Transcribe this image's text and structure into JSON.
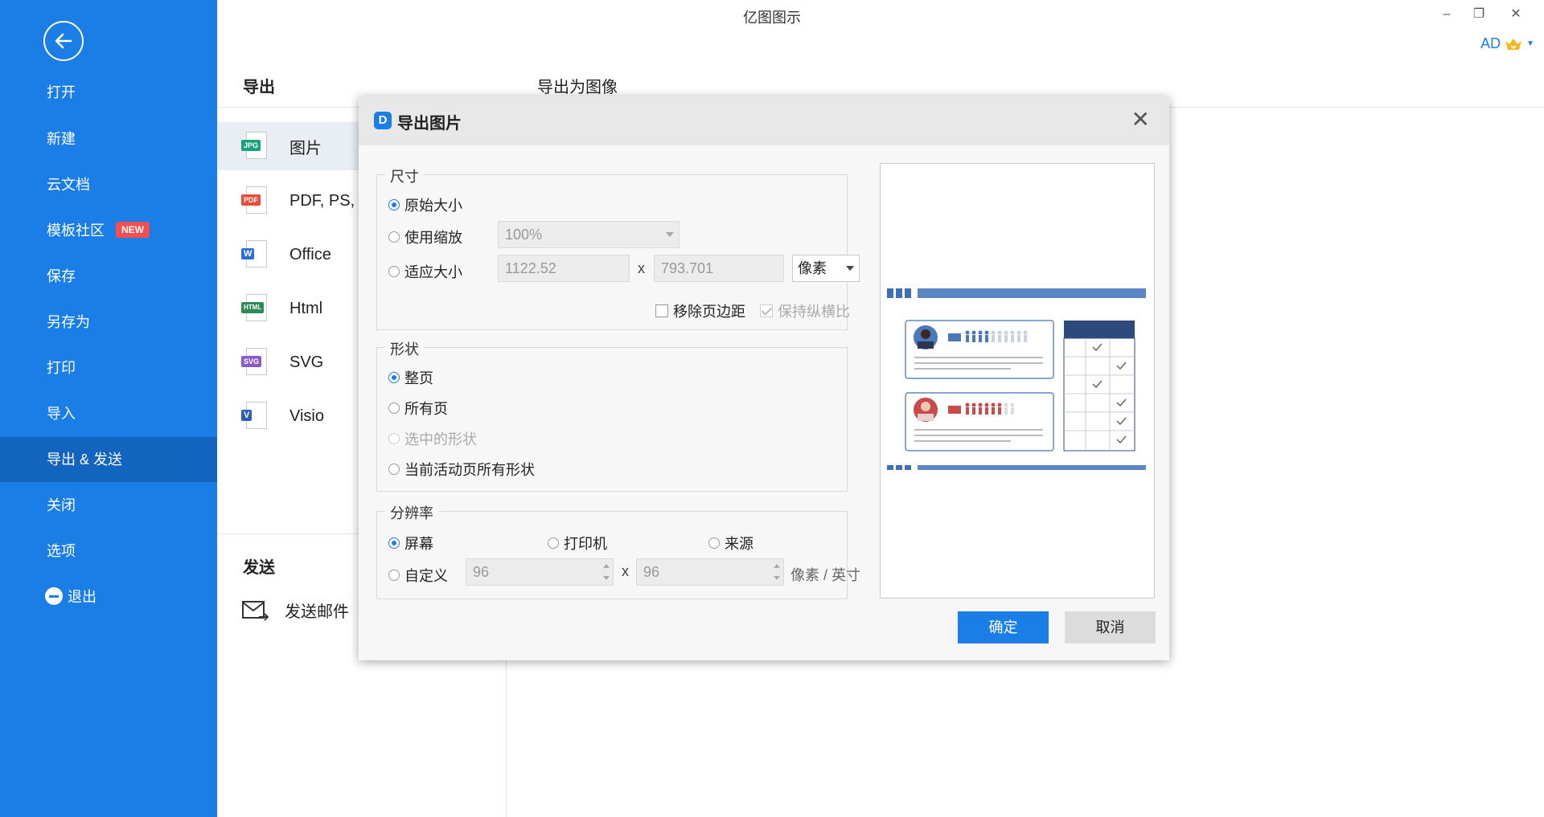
{
  "window": {
    "title": "亿图图示",
    "minimize": "–",
    "restore": "❐",
    "close": "✕"
  },
  "user": {
    "initials": "AD",
    "crown_color": "#f5b81c"
  },
  "colors": {
    "sidebar": "#1a7ee6",
    "sidebar_active": "#1264bf",
    "accent": "#1a7ee6",
    "badge": "#f25050"
  },
  "sidebar": {
    "items": [
      {
        "label": "打开"
      },
      {
        "label": "新建"
      },
      {
        "label": "云文档"
      },
      {
        "label": "模板社区",
        "badge": "NEW"
      },
      {
        "label": "保存"
      },
      {
        "label": "另存为"
      },
      {
        "label": "打印"
      },
      {
        "label": "导入"
      },
      {
        "label": "导出 & 发送"
      },
      {
        "label": "关闭"
      },
      {
        "label": "选项"
      },
      {
        "label": "退出"
      }
    ]
  },
  "export_panel": {
    "title": "导出",
    "subtitle": "导出为图像",
    "formats": [
      {
        "tag": "JPG",
        "label": "图片",
        "color": "#1aa37a"
      },
      {
        "tag": "PDF",
        "label": "PDF, PS, EPS",
        "color": "#e84c3d"
      },
      {
        "tag": "W",
        "label": "Office",
        "color": "#2b6fd6"
      },
      {
        "tag": "HTML",
        "label": "Html",
        "color": "#2e8b57"
      },
      {
        "tag": "SVG",
        "label": "SVG",
        "color": "#8a5cc9"
      },
      {
        "tag": "V",
        "label": "Visio",
        "color": "#2b5fb8"
      }
    ],
    "send_title": "发送",
    "send_email": "发送邮件"
  },
  "dialog": {
    "title": "导出图片",
    "size": {
      "label": "尺寸",
      "original": "原始大小",
      "scale": "使用缩放",
      "scale_value": "100%",
      "fit": "适应大小",
      "width": "1122.52",
      "height": "793.701",
      "unit": "像素",
      "remove_margin": "移除页边距",
      "keep_ratio": "保持纵横比",
      "times": "x"
    },
    "shape": {
      "label": "形状",
      "whole_page": "整页",
      "all_pages": "所有页",
      "selected": "选中的形状",
      "active_page": "当前活动页所有形状"
    },
    "resolution": {
      "label": "分辨率",
      "screen": "屏幕",
      "printer": "打印机",
      "source": "来源",
      "custom": "自定义",
      "dpi_x": "96",
      "dpi_y": "96",
      "unit": "像素 / 英寸",
      "times": "x"
    },
    "ok": "确定",
    "cancel": "取消"
  }
}
